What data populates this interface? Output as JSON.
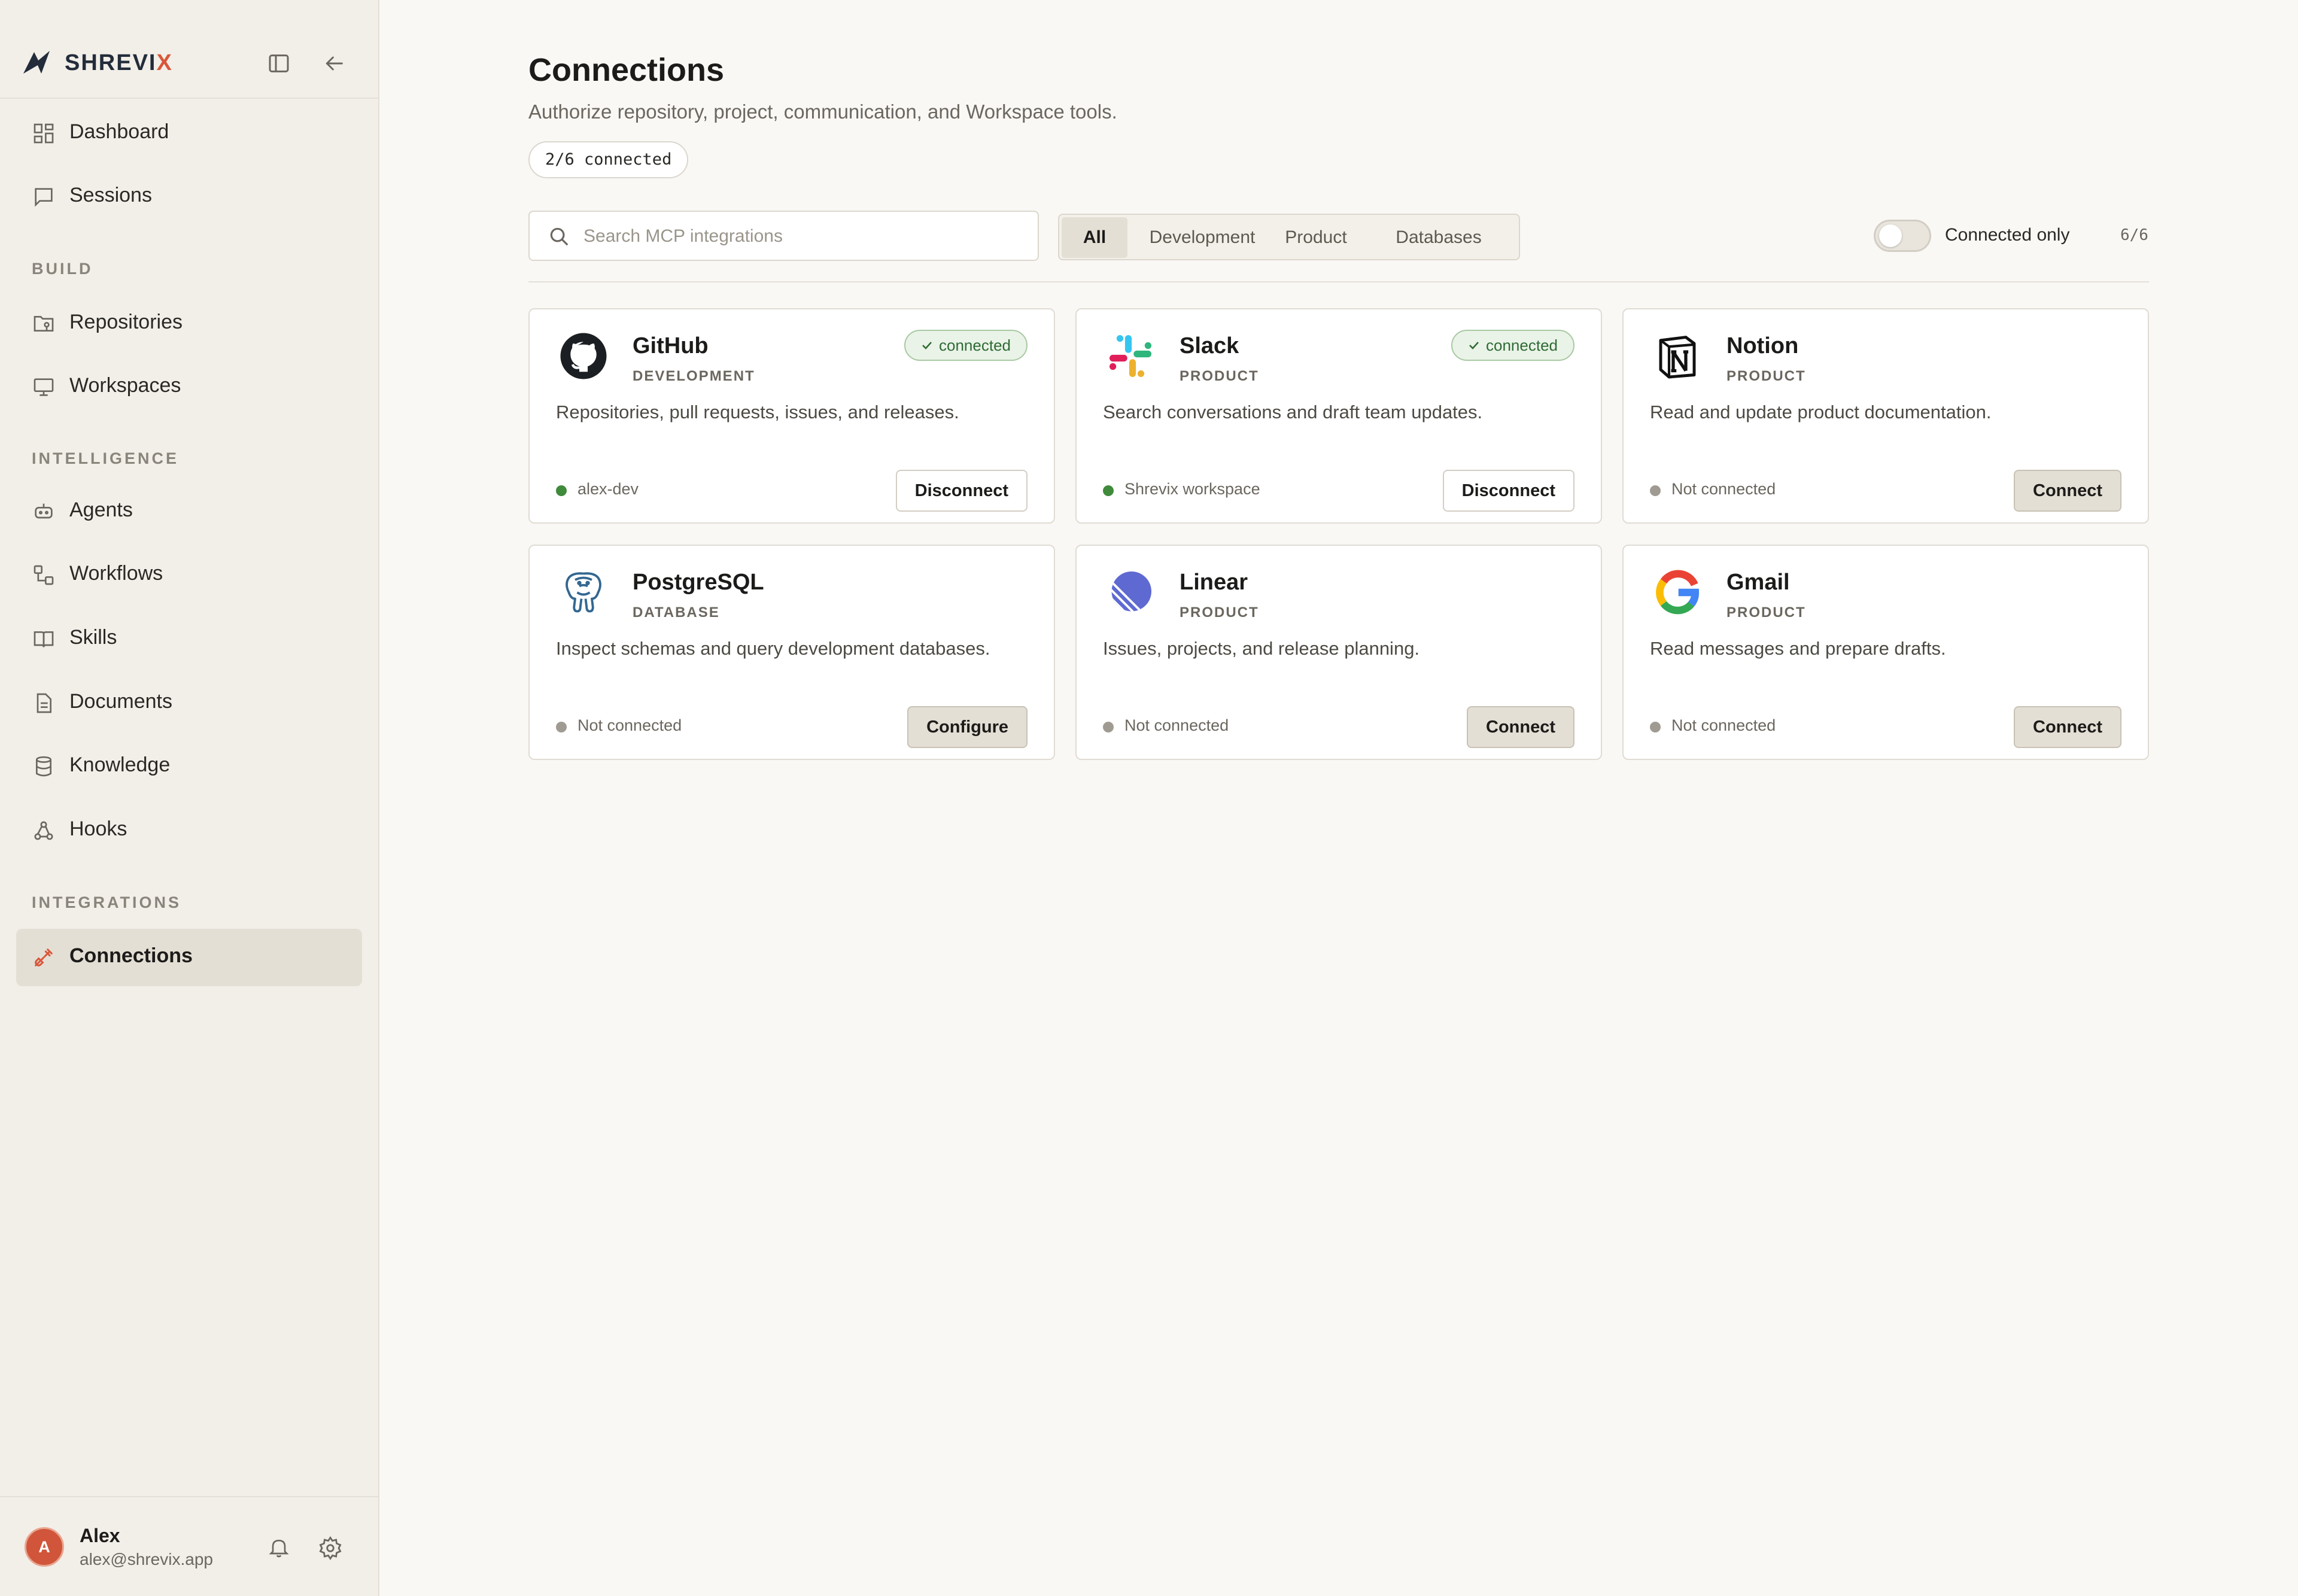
{
  "sidebar": {
    "brand": {
      "main": "SHREVI",
      "accent": "X"
    },
    "nav_top": [
      {
        "label": "Dashboard",
        "icon": "dashboard-icon"
      },
      {
        "label": "Sessions",
        "icon": "chat-icon"
      }
    ],
    "sections": {
      "build": "BUILD",
      "intelligence": "INTELLIGENCE",
      "integrations": "INTEGRATIONS"
    },
    "nav_build": [
      {
        "label": "Repositories",
        "icon": "repository-icon"
      },
      {
        "label": "Workspaces",
        "icon": "monitor-icon"
      }
    ],
    "nav_intelligence": [
      {
        "label": "Agents",
        "icon": "bot-icon"
      },
      {
        "label": "Workflows",
        "icon": "workflow-icon"
      },
      {
        "label": "Skills",
        "icon": "book-icon"
      },
      {
        "label": "Documents",
        "icon": "document-icon"
      },
      {
        "label": "Knowledge",
        "icon": "database-icon"
      },
      {
        "label": "Hooks",
        "icon": "webhook-icon"
      }
    ],
    "nav_integrations": [
      {
        "label": "Connections",
        "icon": "plug-icon",
        "active": true
      }
    ],
    "user": {
      "initial": "A",
      "name": "Alex",
      "email": "alex@shrevix.app"
    }
  },
  "main": {
    "title": "Connections",
    "subtitle": "Authorize repository, project, communication, and Workspace tools.",
    "connected_count": "2/6 connected",
    "search_placeholder": "Search MCP integrations",
    "filters": [
      "All",
      "Development",
      "Product",
      "Databases"
    ],
    "active_filter": "All",
    "toggle_label": "Connected only",
    "toggle_on": false,
    "result_count": "6/6",
    "cards": [
      {
        "name": "GitHub",
        "category": "DEVELOPMENT",
        "description": "Repositories, pull requests, issues, and releases.",
        "badge": "connected",
        "status": "alex-dev",
        "connected": true,
        "action": "Disconnect",
        "logo": "github-logo"
      },
      {
        "name": "Slack",
        "category": "PRODUCT",
        "description": "Search conversations and draft team updates.",
        "badge": "connected",
        "status": "Shrevix workspace",
        "connected": true,
        "action": "Disconnect",
        "logo": "slack-logo"
      },
      {
        "name": "Notion",
        "category": "PRODUCT",
        "description": "Read and update product documentation.",
        "status": "Not connected",
        "connected": false,
        "action": "Connect",
        "logo": "notion-logo"
      },
      {
        "name": "PostgreSQL",
        "category": "DATABASE",
        "description": "Inspect schemas and query development databases.",
        "status": "Not connected",
        "connected": false,
        "action": "Configure",
        "logo": "postgresql-logo"
      },
      {
        "name": "Linear",
        "category": "PRODUCT",
        "description": "Issues, projects, and release planning.",
        "status": "Not connected",
        "connected": false,
        "action": "Connect",
        "logo": "linear-logo"
      },
      {
        "name": "Gmail",
        "category": "PRODUCT",
        "description": "Read messages and prepare drafts.",
        "status": "Not connected",
        "connected": false,
        "action": "Connect",
        "logo": "gmail-logo"
      }
    ]
  },
  "colors": {
    "accent": "#d9573a",
    "connected": "#3f8a3b",
    "sidebar_bg": "#f2efe9",
    "page_bg": "#f9f8f5"
  }
}
